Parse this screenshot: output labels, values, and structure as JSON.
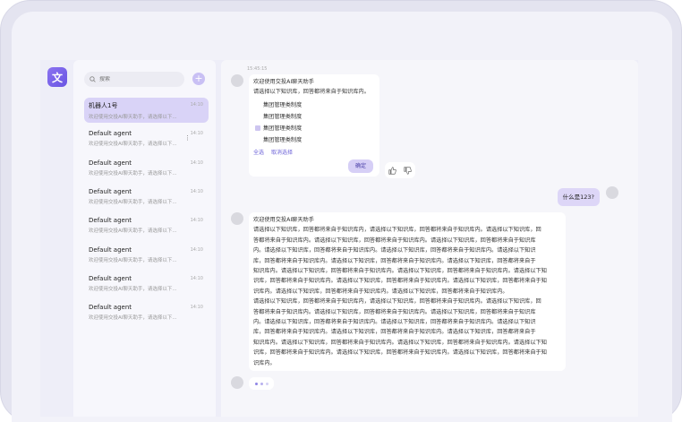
{
  "app": {
    "logo_char": "文"
  },
  "sidebar": {
    "search_placeholder": "搜索",
    "add_label": "+",
    "conversations": [
      {
        "name": "机器人1号",
        "preview": "欢迎使用交投AI聊天助手，请选择以下...",
        "time": "14:10",
        "active": true
      },
      {
        "name": "Default agent",
        "preview": "欢迎使用交投AI聊天助手，请选择以下...",
        "time": "14:10"
      },
      {
        "name": "Default agent",
        "preview": "欢迎使用交投AI聊天助手，请选择以下...",
        "time": "14:10"
      },
      {
        "name": "Default agent",
        "preview": "欢迎使用交投AI聊天助手，请选择以下...",
        "time": "14:10"
      },
      {
        "name": "Default agent",
        "preview": "欢迎使用交投AI聊天助手，请选择以下...",
        "time": "14:10"
      },
      {
        "name": "Default agent",
        "preview": "欢迎使用交投AI聊天助手，请选择以下...",
        "time": "14:10"
      },
      {
        "name": "Default agent",
        "preview": "欢迎使用交投AI聊天助手，请选择以下...",
        "time": "14:10"
      },
      {
        "name": "Default agent",
        "preview": "欢迎使用交投AI聊天助手，请选择以下...",
        "time": "14:10"
      }
    ],
    "more_icon": "⋮"
  },
  "chat": {
    "timestamp": "15:45:15",
    "welcome": {
      "title": "欢迎使用交投AI聊天助手",
      "subtitle": "请选择以下知识库，回答都将来自于知识库内。",
      "options": [
        {
          "label": "集团管理类制度",
          "checked": false
        },
        {
          "label": "集团管理类制度",
          "checked": false
        },
        {
          "label": "集团管理类制度",
          "checked": true
        },
        {
          "label": "集团管理类制度",
          "checked": false
        }
      ],
      "select_all": "全选",
      "cancel_select": "取消选择",
      "confirm": "确定"
    },
    "user_message": "什么是123?",
    "answer": {
      "title": "欢迎使用交投AI聊天助手",
      "lines": [
        "请选择以下知识库，回答都将来自于知识库内，请选择以下知识库，回答都将来自于知识库内。请选择以下知识库，回",
        "答都将来自于知识库内。请选择以下知识库，回答都将来自于知识库内。请选择以下知识库，回答都将来自于知识库",
        "内。请选择以下知识库，回答都将来自于知识库内。请选择以下知识库，回答都将来自于知识库内。请选择以下知识",
        "库，回答都将来自于知识库内。请选择以下知识库，回答都将来自于知识库内。请选择以下知识库，回答都将来自于",
        "知识库内。请选择以下知识库，回答都将来自于知识库内。请选择以下知识库，回答都将来自于知识库内。请选择以下知",
        "识库，回答都将来自于知识库内。请选择以下知识库，回答都将来自于知识库内。请选择以下知识库，回答都将来自于知",
        "识库内。请选择以下知识库，回答都将来自于知识库内。请选择以下知识库，回答都将来自于知识库内。",
        "请选择以下知识库，回答都将来自于知识库内，请选择以下知识库，回答都将来自于知识库内。请选择以下知识库，回",
        "答都将来自于知识库内。请选择以下知识库，回答都将来自于知识库内。请选择以下知识库，回答都将来自于知识库",
        "内。请选择以下知识库，回答都将来自于知识库内。请选择以下知识库，回答都将来自于知识库内。请选择以下知识",
        "库，回答都将来自于知识库内。请选择以下知识库，回答都将来自于知识库内。请选择以下知识库，回答都将来自于",
        "知识库内。请选择以下知识库，回答都将来自于知识库内。请选择以下知识库，回答都将来自于知识库内。请选择以下知",
        "识库，回答都将来自于知识库内。请选择以下知识库，回答都将来自于知识库内。请选择以下知识库，回答都将来自于知",
        "识库内。"
      ]
    },
    "typing_colors": [
      "#8f86e6",
      "#b7b0ee",
      "#d5d1f3"
    ]
  },
  "colors": {
    "accent": "#6d63d8",
    "active_bg": "#d9d3f7"
  }
}
